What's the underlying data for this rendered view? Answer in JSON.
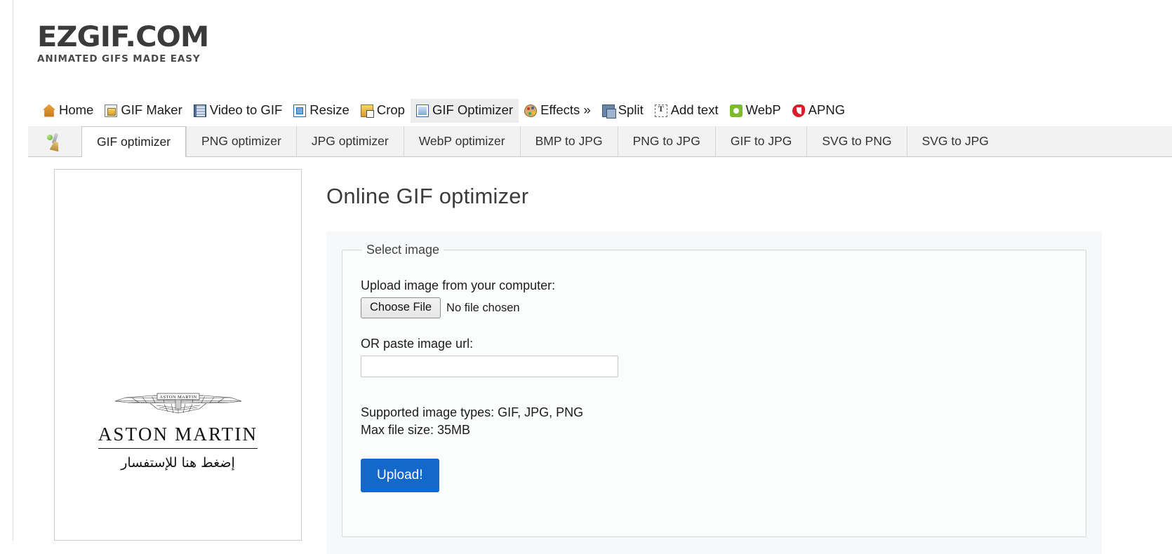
{
  "site": {
    "logo_main": "EZGIF.COM",
    "logo_sub": "ANIMATED GIFS MADE EASY"
  },
  "mainnav": {
    "items": [
      {
        "label": "Home",
        "icon": "home-icon"
      },
      {
        "label": "GIF Maker",
        "icon": "gif-maker-icon"
      },
      {
        "label": "Video to GIF",
        "icon": "video-to-gif-icon"
      },
      {
        "label": "Resize",
        "icon": "resize-icon"
      },
      {
        "label": "Crop",
        "icon": "crop-icon"
      },
      {
        "label": "GIF Optimizer",
        "icon": "gif-optimizer-icon"
      },
      {
        "label": "Effects »",
        "icon": "effects-palette-icon"
      },
      {
        "label": "Split",
        "icon": "split-icon"
      },
      {
        "label": "Add text",
        "icon": "add-text-icon"
      },
      {
        "label": "WebP",
        "icon": "webp-icon"
      },
      {
        "label": "APNG",
        "icon": "apng-icon"
      }
    ],
    "active": "GIF Optimizer"
  },
  "subnav": {
    "icon": "broom-icon",
    "tabs": [
      "GIF optimizer",
      "PNG optimizer",
      "JPG optimizer",
      "WebP optimizer",
      "BMP to JPG",
      "PNG to JPG",
      "GIF to JPG",
      "SVG to PNG",
      "SVG to JPG"
    ],
    "active": "GIF optimizer"
  },
  "ad": {
    "brand_name": "ASTON MARTIN",
    "wings_text": "ASTON MARTIN",
    "arabic_text": "إضغط هنا للإستفسار"
  },
  "main": {
    "title": "Online GIF optimizer",
    "fieldset_legend": "Select image",
    "upload_label": "Upload image from your computer:",
    "choose_file_label": "Choose File",
    "no_file_chosen": "No file chosen",
    "url_label": "OR paste image url:",
    "url_value": "",
    "url_placeholder": "",
    "supported_types": "Supported image types: GIF, JPG, PNG",
    "max_file_size": "Max file size: 35MB",
    "upload_button": "Upload!"
  },
  "colors": {
    "accent": "#1268cb",
    "panel_bg": "#f7f8f9",
    "subnav_bg": "#f2f2f2"
  }
}
